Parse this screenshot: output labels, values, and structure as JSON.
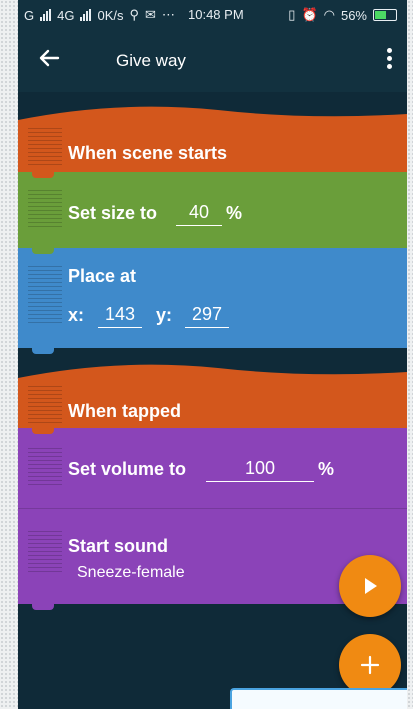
{
  "statusbar": {
    "network": "G",
    "network2": "4G",
    "speed": "0K/s",
    "time": "10:48 PM",
    "battery": "56%",
    "battery_level": 0.56
  },
  "appbar": {
    "title": "Give way",
    "back_icon": "arrow-left-icon",
    "menu_icon": "more-vertical-icon"
  },
  "blocks": {
    "scene_starts": "When scene starts",
    "set_size_label": "Set size to",
    "set_size_value": "40",
    "set_size_unit": "%",
    "place_at_label": "Place at",
    "x_label": "x:",
    "x_value": "143",
    "y_label": "y:",
    "y_value": "297",
    "when_tapped": "When tapped",
    "set_volume_label": "Set volume to",
    "set_volume_value": "100",
    "set_volume_unit": "%",
    "start_sound_label": "Start sound",
    "sound_name": "Sneeze-female"
  },
  "colors": {
    "hat": "#d3571c",
    "looks": "#6a9e3a",
    "motion": "#3f8acb",
    "sound": "#8b43b8",
    "fab": "#f08a12",
    "background": "#0f2a38"
  },
  "fabs": {
    "play_icon": "play-icon",
    "add_icon": "plus-icon"
  }
}
